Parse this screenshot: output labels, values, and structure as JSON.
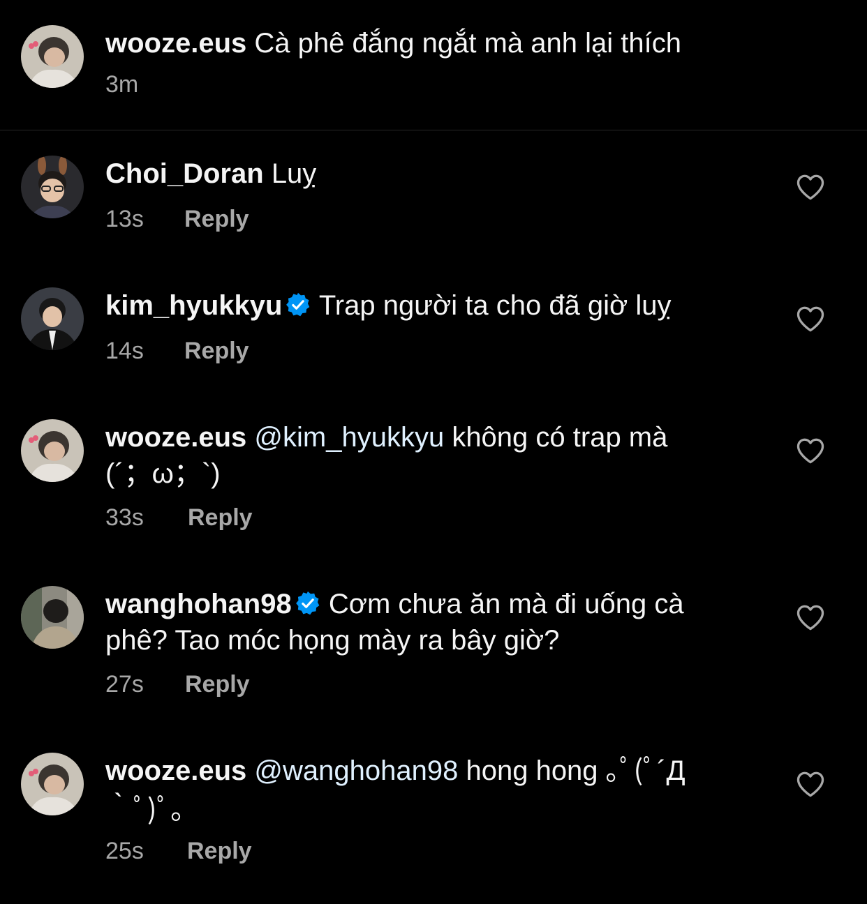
{
  "caption": {
    "username": "wooze.eus",
    "text": "Cà phê đắng ngắt mà anh lại thích",
    "time": "3m"
  },
  "comments": [
    {
      "username": "Choi_Doran",
      "verified": false,
      "text": "Luỵ",
      "time": "13s",
      "reply_label": "Reply",
      "like_icon": "heart-outline-icon"
    },
    {
      "username": "kim_hyukkyu",
      "verified": true,
      "text": "Trap người ta cho đã giờ luỵ",
      "time": "14s",
      "reply_label": "Reply",
      "like_icon": "heart-outline-icon"
    },
    {
      "username": "wooze.eus",
      "verified": false,
      "mention": "@kim_hyukkyu",
      "text": "không có trap mà",
      "text_line2": "(´；ω；`)",
      "time": "33s",
      "reply_label": "Reply",
      "like_icon": "heart-outline-icon"
    },
    {
      "username": "wanghohan98",
      "verified": true,
      "text": "Cơm chưa ăn mà đi uống cà",
      "text_line2": "phê? Tao móc họng mày ra bây giờ?",
      "time": "27s",
      "reply_label": "Reply",
      "like_icon": "heart-outline-icon"
    },
    {
      "username": "wooze.eus",
      "verified": false,
      "mention": "@wanghohan98",
      "text": "hong hong ｡ﾟ(ﾟ´Д",
      "text_line2": "｀ﾟ)ﾟ｡",
      "time": "25s",
      "reply_label": "Reply",
      "like_icon": "heart-outline-icon"
    }
  ],
  "colors": {
    "background": "#000000",
    "text": "#f5f5f5",
    "secondary_text": "#a8a8a8",
    "mention": "#e0f1ff",
    "verified_badge": "#0095f6",
    "divider": "#262626"
  }
}
